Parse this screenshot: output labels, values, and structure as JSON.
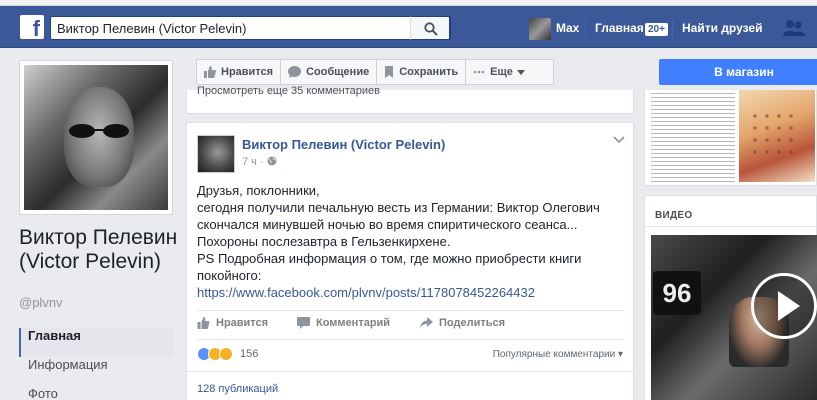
{
  "header": {
    "logo_letter": "f",
    "search_value": "Виктор Пелевин (Victor Pelevin)",
    "user_name": "Max",
    "home_label": "Главная",
    "home_badge": "20+",
    "find_friends_label": "Найти друзей",
    "brand_color": "#3b5998"
  },
  "profile": {
    "name": "Виктор Пелевин (Victor Pelevin)",
    "handle": "@plvnv",
    "nav": [
      {
        "label": "Главная",
        "active": true
      },
      {
        "label": "Информация",
        "active": false
      },
      {
        "label": "Фото",
        "active": false
      }
    ]
  },
  "action_bar": {
    "like_label": "Нравится",
    "message_label": "Сообщение",
    "save_label": "Сохранить",
    "more_label": "Еще",
    "shop_label": "В магазин"
  },
  "previous_post": {
    "more_comments": "Просмотреть еще 35 комментариев"
  },
  "post": {
    "author": "Виктор Пелевин (Victor Pelevin)",
    "time": "7 ч",
    "lines": [
      "Друзья, поклонники,",
      "сегодня получили печальную весть из Германии: Виктор Олегович",
      "скончался минувшей ночью во время спиритического сеанса...",
      "Похороны послезавтра в Гельзенкирхене.",
      "PS Подробная информация о том, где можно приобрести книги",
      "покойного:"
    ],
    "link": "https://www.facebook.com/plvnv/posts/1178078452264432",
    "like_action": "Нравится",
    "comment_action": "Комментарий",
    "share_action": "Поделиться",
    "reactions_count": "156",
    "comments_sort": "Популярные комментарии",
    "publications": "128 публикаций"
  },
  "right": {
    "video_title": "ВИДЕО"
  }
}
